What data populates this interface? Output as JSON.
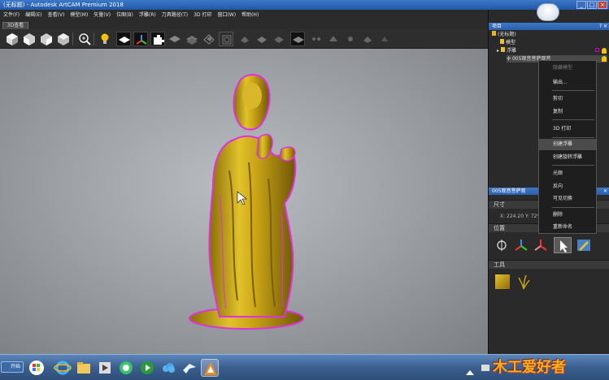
{
  "window": {
    "title": "(无标题) - Autodesk ArtCAM Premium 2018",
    "controls": [
      "minimize-icon",
      "maximize-icon",
      "close-icon"
    ]
  },
  "menu": [
    "文件(F)",
    "编辑(E)",
    "查看(V)",
    "模型(M)",
    "矢量(V)",
    "位图(B)",
    "浮雕(R)",
    "刀具路径(T)",
    "3D 打印",
    "窗口(W)",
    "帮助(H)"
  ],
  "tabs": [
    "3D查看"
  ],
  "toolbar": [
    "view-iso-icon",
    "view-front-icon",
    "view-left-icon",
    "view-right-icon",
    "zoom-icon",
    "light-bulb-icon",
    "flat-plane-icon",
    "axes-icon",
    "puzzle-icon",
    "shaded-icon",
    "wire-icon",
    "layers-icon",
    "grid-icon",
    "relief-icon",
    "box-icon",
    "settings-icon"
  ],
  "project": {
    "title": "项目",
    "header_buttons": "? ✕",
    "root": "(无标题)",
    "model": "模型",
    "reliefs": "浮雕",
    "selected": "005观音菩萨观音"
  },
  "context_menu": [
    {
      "label": "隐藏模型",
      "disabled": true
    },
    {
      "label": "输出..."
    },
    {
      "sep": true
    },
    {
      "label": "剪切"
    },
    {
      "label": "复制"
    },
    {
      "sep": true
    },
    {
      "label": "3D 打印"
    },
    {
      "sep": true
    },
    {
      "label": "创建浮雕",
      "highlight": true
    },
    {
      "label": "创建旋转浮雕"
    },
    {
      "sep": true
    },
    {
      "label": "光顺"
    },
    {
      "label": "反向"
    },
    {
      "label": "可见切换"
    },
    {
      "sep": true
    },
    {
      "label": "删除"
    },
    {
      "label": "重新命名"
    }
  ],
  "properties": {
    "title": "005观音菩萨观",
    "size_section": "尺寸",
    "coords": "X: 224.20  Y: 72%",
    "position_section": "位置",
    "tools_section": "工具"
  },
  "taskbar": {
    "start": "开始",
    "apps": [
      "windows-logo-icon",
      "ie-icon",
      "folder-icon",
      "media-icon",
      "ie2-icon",
      "media-play-icon",
      "cloud-icon",
      "bird-icon",
      "artcam-icon"
    ],
    "watermark": "木工爱好者"
  },
  "colors": {
    "accent": "#2a5fab",
    "statue_gold": "#c9a416",
    "outline": "#e030e0"
  }
}
